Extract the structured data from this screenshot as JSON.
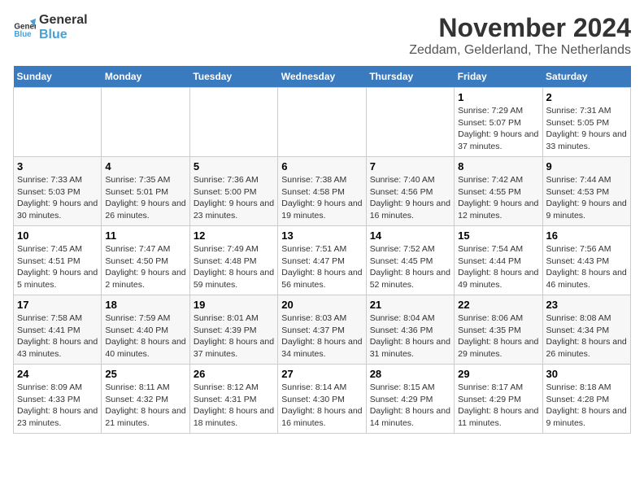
{
  "header": {
    "logo_line1": "General",
    "logo_line2": "Blue",
    "month": "November 2024",
    "location": "Zeddam, Gelderland, The Netherlands"
  },
  "days_of_week": [
    "Sunday",
    "Monday",
    "Tuesday",
    "Wednesday",
    "Thursday",
    "Friday",
    "Saturday"
  ],
  "weeks": [
    [
      {
        "day": "",
        "info": ""
      },
      {
        "day": "",
        "info": ""
      },
      {
        "day": "",
        "info": ""
      },
      {
        "day": "",
        "info": ""
      },
      {
        "day": "",
        "info": ""
      },
      {
        "day": "1",
        "info": "Sunrise: 7:29 AM\nSunset: 5:07 PM\nDaylight: 9 hours and 37 minutes."
      },
      {
        "day": "2",
        "info": "Sunrise: 7:31 AM\nSunset: 5:05 PM\nDaylight: 9 hours and 33 minutes."
      }
    ],
    [
      {
        "day": "3",
        "info": "Sunrise: 7:33 AM\nSunset: 5:03 PM\nDaylight: 9 hours and 30 minutes."
      },
      {
        "day": "4",
        "info": "Sunrise: 7:35 AM\nSunset: 5:01 PM\nDaylight: 9 hours and 26 minutes."
      },
      {
        "day": "5",
        "info": "Sunrise: 7:36 AM\nSunset: 5:00 PM\nDaylight: 9 hours and 23 minutes."
      },
      {
        "day": "6",
        "info": "Sunrise: 7:38 AM\nSunset: 4:58 PM\nDaylight: 9 hours and 19 minutes."
      },
      {
        "day": "7",
        "info": "Sunrise: 7:40 AM\nSunset: 4:56 PM\nDaylight: 9 hours and 16 minutes."
      },
      {
        "day": "8",
        "info": "Sunrise: 7:42 AM\nSunset: 4:55 PM\nDaylight: 9 hours and 12 minutes."
      },
      {
        "day": "9",
        "info": "Sunrise: 7:44 AM\nSunset: 4:53 PM\nDaylight: 9 hours and 9 minutes."
      }
    ],
    [
      {
        "day": "10",
        "info": "Sunrise: 7:45 AM\nSunset: 4:51 PM\nDaylight: 9 hours and 5 minutes."
      },
      {
        "day": "11",
        "info": "Sunrise: 7:47 AM\nSunset: 4:50 PM\nDaylight: 9 hours and 2 minutes."
      },
      {
        "day": "12",
        "info": "Sunrise: 7:49 AM\nSunset: 4:48 PM\nDaylight: 8 hours and 59 minutes."
      },
      {
        "day": "13",
        "info": "Sunrise: 7:51 AM\nSunset: 4:47 PM\nDaylight: 8 hours and 56 minutes."
      },
      {
        "day": "14",
        "info": "Sunrise: 7:52 AM\nSunset: 4:45 PM\nDaylight: 8 hours and 52 minutes."
      },
      {
        "day": "15",
        "info": "Sunrise: 7:54 AM\nSunset: 4:44 PM\nDaylight: 8 hours and 49 minutes."
      },
      {
        "day": "16",
        "info": "Sunrise: 7:56 AM\nSunset: 4:43 PM\nDaylight: 8 hours and 46 minutes."
      }
    ],
    [
      {
        "day": "17",
        "info": "Sunrise: 7:58 AM\nSunset: 4:41 PM\nDaylight: 8 hours and 43 minutes."
      },
      {
        "day": "18",
        "info": "Sunrise: 7:59 AM\nSunset: 4:40 PM\nDaylight: 8 hours and 40 minutes."
      },
      {
        "day": "19",
        "info": "Sunrise: 8:01 AM\nSunset: 4:39 PM\nDaylight: 8 hours and 37 minutes."
      },
      {
        "day": "20",
        "info": "Sunrise: 8:03 AM\nSunset: 4:37 PM\nDaylight: 8 hours and 34 minutes."
      },
      {
        "day": "21",
        "info": "Sunrise: 8:04 AM\nSunset: 4:36 PM\nDaylight: 8 hours and 31 minutes."
      },
      {
        "day": "22",
        "info": "Sunrise: 8:06 AM\nSunset: 4:35 PM\nDaylight: 8 hours and 29 minutes."
      },
      {
        "day": "23",
        "info": "Sunrise: 8:08 AM\nSunset: 4:34 PM\nDaylight: 8 hours and 26 minutes."
      }
    ],
    [
      {
        "day": "24",
        "info": "Sunrise: 8:09 AM\nSunset: 4:33 PM\nDaylight: 8 hours and 23 minutes."
      },
      {
        "day": "25",
        "info": "Sunrise: 8:11 AM\nSunset: 4:32 PM\nDaylight: 8 hours and 21 minutes."
      },
      {
        "day": "26",
        "info": "Sunrise: 8:12 AM\nSunset: 4:31 PM\nDaylight: 8 hours and 18 minutes."
      },
      {
        "day": "27",
        "info": "Sunrise: 8:14 AM\nSunset: 4:30 PM\nDaylight: 8 hours and 16 minutes."
      },
      {
        "day": "28",
        "info": "Sunrise: 8:15 AM\nSunset: 4:29 PM\nDaylight: 8 hours and 14 minutes."
      },
      {
        "day": "29",
        "info": "Sunrise: 8:17 AM\nSunset: 4:29 PM\nDaylight: 8 hours and 11 minutes."
      },
      {
        "day": "30",
        "info": "Sunrise: 8:18 AM\nSunset: 4:28 PM\nDaylight: 8 hours and 9 minutes."
      }
    ]
  ]
}
